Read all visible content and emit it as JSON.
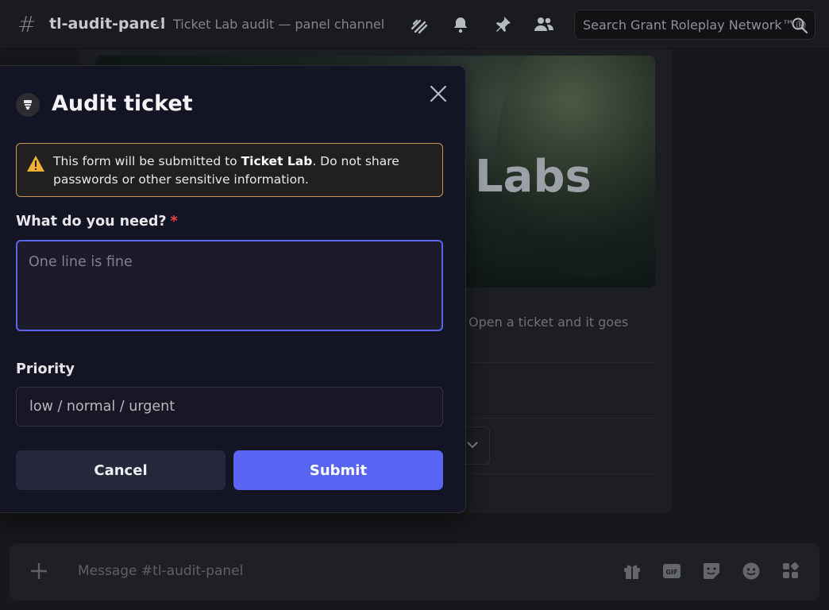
{
  "header": {
    "channel_name": "tl-audit-panel",
    "topic": "Ticket Lab audit — panel channel",
    "search_placeholder": "Search Grant Roleplay Network™®"
  },
  "background": {
    "banner_text": "Labs",
    "description": "Open a ticket and it goes"
  },
  "composer": {
    "placeholder": "Message #tl-audit-panel"
  },
  "modal": {
    "title": "Audit ticket",
    "warning": {
      "prefix": "This form will be submitted to ",
      "app_name": "Ticket Lab",
      "suffix": ". Do not share passwords or other sensitive information."
    },
    "field_need": {
      "label": "What do you need?",
      "required_mark": "*",
      "placeholder": "One line is fine"
    },
    "field_priority": {
      "label": "Priority",
      "placeholder": "low / normal / urgent"
    },
    "cancel_label": "Cancel",
    "submit_label": "Submit"
  },
  "colors": {
    "accent": "#5865f2",
    "warning_border": "#c59a5a",
    "required": "#f23f43"
  }
}
